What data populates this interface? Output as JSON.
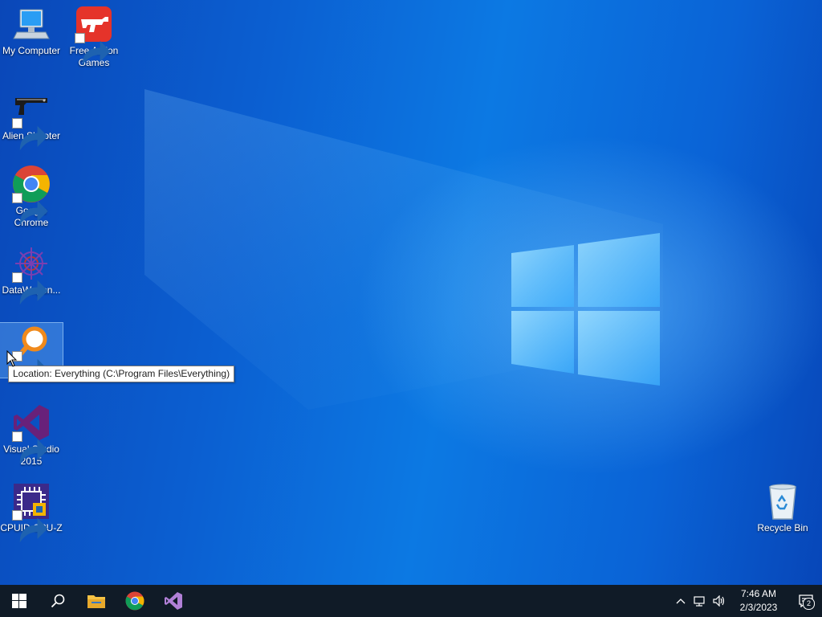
{
  "desktop": {
    "icons": [
      {
        "label": "My Computer",
        "icon": "computer-icon"
      },
      {
        "label": "Free Action Games",
        "icon": "gun-game-icon"
      },
      {
        "label": "Alien Shooter",
        "icon": "pistol-icon"
      },
      {
        "label": "Google Chrome",
        "icon": "chrome-icon"
      },
      {
        "label": "DataWagon...",
        "icon": "datawagon-icon"
      },
      {
        "label": "Everything",
        "icon": "magnifier-icon"
      },
      {
        "label": "Visual Studio 2015",
        "icon": "visual-studio-icon"
      },
      {
        "label": "CPUID CPU-Z",
        "icon": "cpu-z-icon"
      },
      {
        "label": "Recycle Bin",
        "icon": "recycle-bin-icon"
      }
    ],
    "tooltip": "Location: Everything (C:\\Program Files\\Everything)"
  },
  "taskbar": {
    "pinned": [
      "start-icon",
      "search-icon",
      "file-explorer-icon",
      "chrome-icon",
      "visual-studio-icon"
    ],
    "clock": {
      "time": "7:46 AM",
      "date": "2/3/2023"
    },
    "notification_count": "2"
  },
  "colors": {
    "taskbar": "#101b27",
    "desktop_accent": "#0b6fdd"
  }
}
